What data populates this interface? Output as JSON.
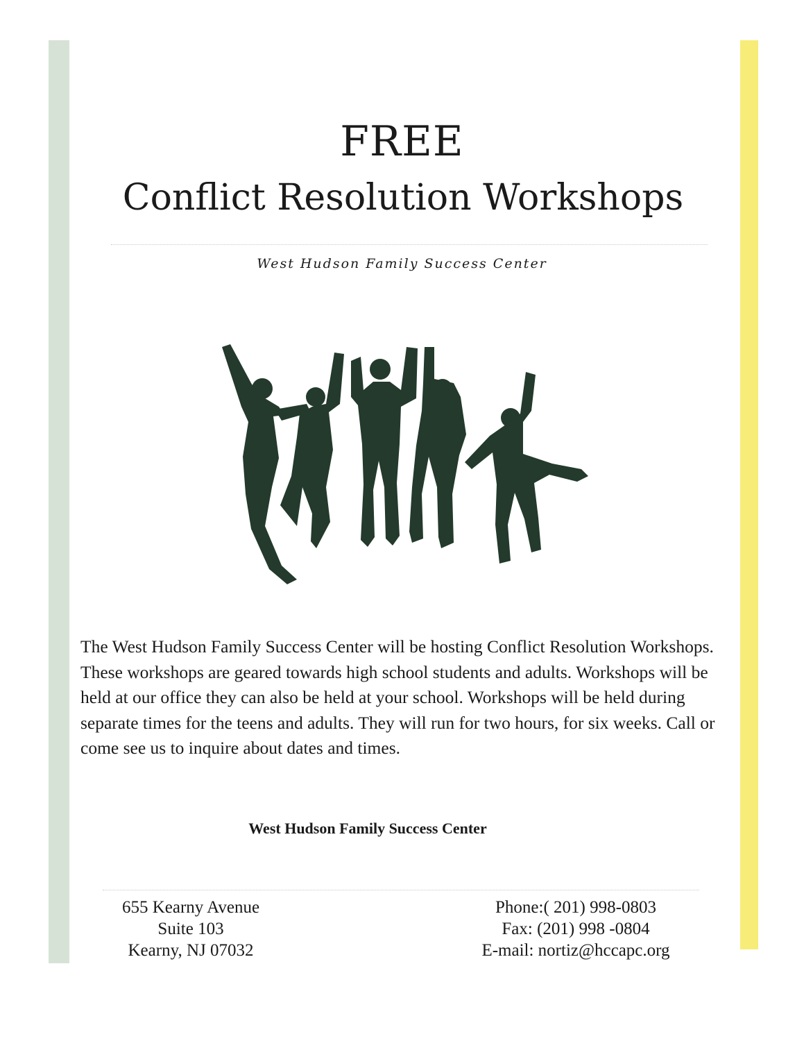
{
  "flyer": {
    "title_line1": "FREE",
    "title_line2": "Conflict Resolution Workshops",
    "subtitle": "West Hudson Family Success Center",
    "illustration_icon": "jumping-people-silhouette-icon",
    "body": "The West Hudson Family Success Center  will be hosting Conflict Resolution Workshops.  These workshops are geared towards high school students  and adults.  Workshops will be held at our office they can also be held at your school. Workshops will be held during separate times for the teens and adults. They  will run for two hours, for six weeks.  Call  or come see us to inquire about dates and times.",
    "organization": "West Hudson Family Success Center",
    "address": {
      "street": "655 Kearny Avenue",
      "suite": "Suite 103",
      "city": "Kearny, NJ 07032"
    },
    "contact": {
      "phone": "Phone:( 201) 998-0803",
      "fax": "Fax: (201) 998 -0804",
      "email": "E-mail: nortiz@hccapc.org"
    },
    "colors": {
      "left_stripe": "#d6e2d6",
      "right_stripe": "#f8ec78",
      "silhouette": "#233a2c"
    }
  }
}
